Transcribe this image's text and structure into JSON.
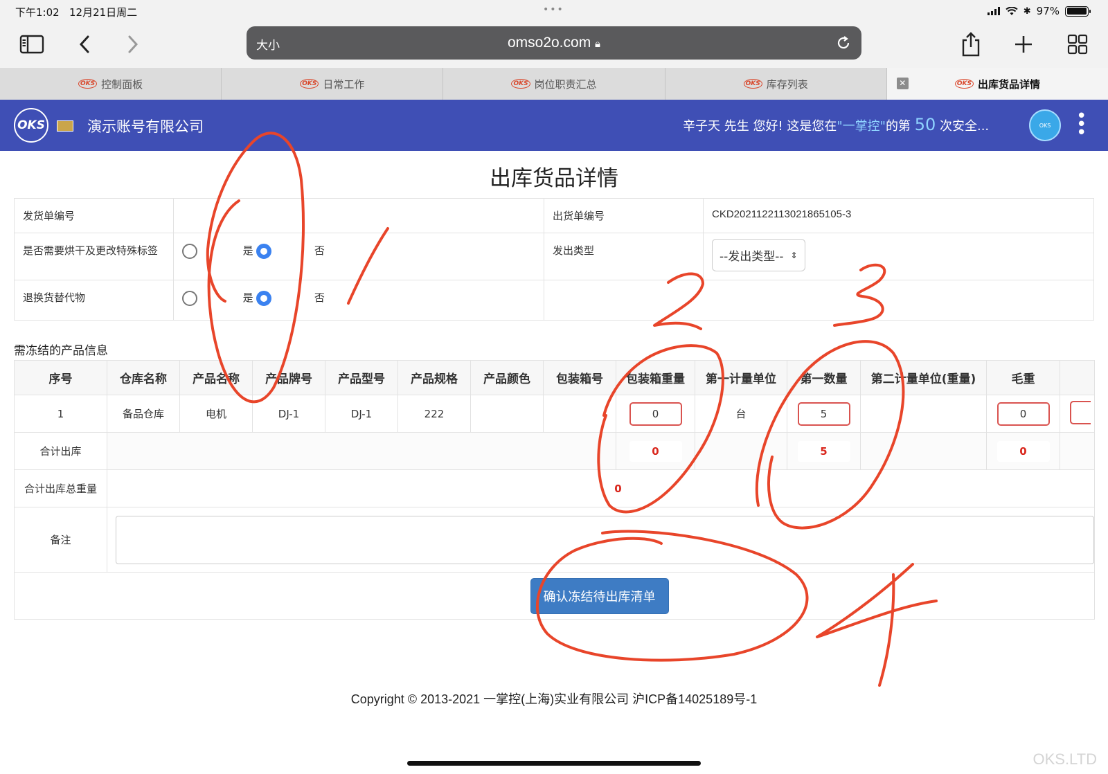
{
  "status": {
    "time": "下午1:02",
    "date": "12月21日周二",
    "battery": "97%",
    "battery_level": 0.97
  },
  "browser": {
    "text_size": "大小",
    "url": "omso2o.com"
  },
  "tabs": [
    {
      "label": "控制面板",
      "active": false
    },
    {
      "label": "日常工作",
      "active": false
    },
    {
      "label": "岗位职责汇总",
      "active": false
    },
    {
      "label": "库存列表",
      "active": false
    },
    {
      "label": "出库货品详情",
      "active": true
    }
  ],
  "tab_logo_text": "OKS",
  "header": {
    "logo_text": "OKS",
    "company": "演示账号有限公司",
    "greeting_prefix": "辛子天 先生 您好! 这是您在",
    "greeting_brand": "\"一掌控\"",
    "greeting_mid": "的第",
    "greeting_count": "50",
    "greeting_suffix": "次安全...",
    "accent": "#3f4fb5"
  },
  "page": {
    "title": "出库货品详情",
    "form": {
      "shipping_no_label": "发货单编号",
      "shipping_no_value": "",
      "outbound_no_label": "出货单编号",
      "outbound_no_value": "CKD2021122113021865105-3",
      "special_label_q": "是否需要烘干及更改特殊标签",
      "dispatch_type_label": "发出类型",
      "dispatch_type_value": "--发出类型--",
      "replacement_q": "退换货替代物",
      "yes": "是",
      "no": "否"
    },
    "section_title": "需冻结的产品信息",
    "columns": [
      "序号",
      "仓库名称",
      "产品名称",
      "产品牌号",
      "产品型号",
      "产品规格",
      "产品颜色",
      "包装箱号",
      "包装箱重量",
      "第一计量单位",
      "第一数量",
      "第二计量单位(重量)",
      "毛重"
    ],
    "rows": [
      {
        "index": "1",
        "warehouse": "备品仓库",
        "product_name": "电机",
        "brand_no": "DJ-1",
        "model": "DJ-1",
        "spec": "222",
        "color": "",
        "box_no": "",
        "box_weight": "0",
        "unit1": "台",
        "qty1": "5",
        "unit2": "",
        "gross": "0"
      }
    ],
    "total_label": "合计出库",
    "total_box_weight": "0",
    "total_qty1": "5",
    "total_gross": "0",
    "total_weight_label": "合计出库总重量",
    "total_weight_value": "0",
    "remarks_label": "备注",
    "remarks_value": "",
    "confirm_button": "确认冻结待出库清单"
  },
  "footer": {
    "copyright": "Copyright © 2013-2021 一掌控(上海)实业有限公司 沪ICP备14025189号-1"
  },
  "watermark": "OKS.LTD",
  "annotations": {
    "color": "#e8452a",
    "numbers": [
      "1",
      "2",
      "3",
      "4"
    ]
  }
}
